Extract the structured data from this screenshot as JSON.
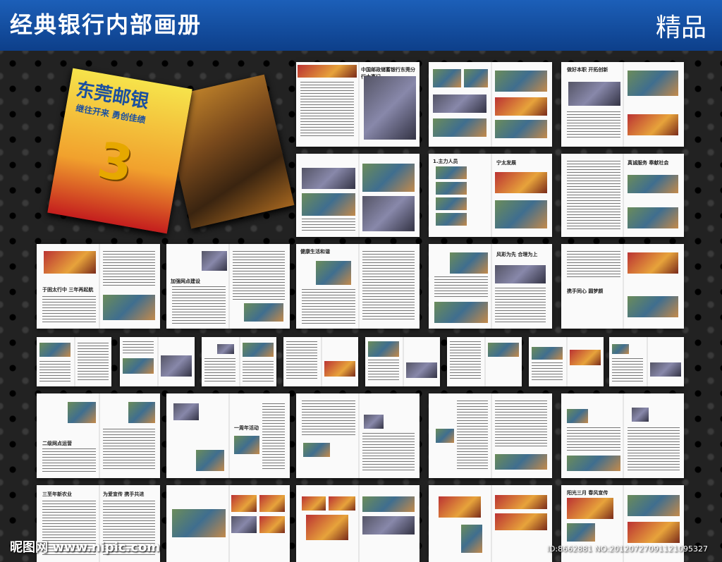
{
  "header": {
    "title": "经典银行内部画册",
    "badge": "精品"
  },
  "cover": {
    "logo": "东莞邮银",
    "slogan": "继往开来 勇创佳绩",
    "number": "3"
  },
  "spreads": [
    {
      "heading": "中国邮政储蓄银行东莞分行大事记"
    },
    {
      "heading": ""
    },
    {
      "heading": "做好本职 开拓创新"
    },
    {
      "heading": ""
    },
    {
      "heading": "1.主力人员"
    },
    {
      "heading": "宁太发展"
    },
    {
      "heading": "真诚服务 奉献社会"
    },
    {
      "heading": "于困太行中 三年再起航"
    },
    {
      "heading": "加强网点建设"
    },
    {
      "heading": "健康生活和谐"
    },
    {
      "heading": "风彩为先 合理为上"
    },
    {
      "heading": "携手同心 圆梦颜"
    },
    {
      "heading": "二级网点运营"
    },
    {
      "heading": "一周年活动"
    },
    {
      "heading": "三至年新农业"
    },
    {
      "heading": "为爱宣传 携手共进"
    },
    {
      "heading": "阳光三月 春风宣传"
    }
  ],
  "watermark": {
    "left": "昵图网 www.nipic.com",
    "right": "ID:8662881 NO:20120727091121095327"
  }
}
